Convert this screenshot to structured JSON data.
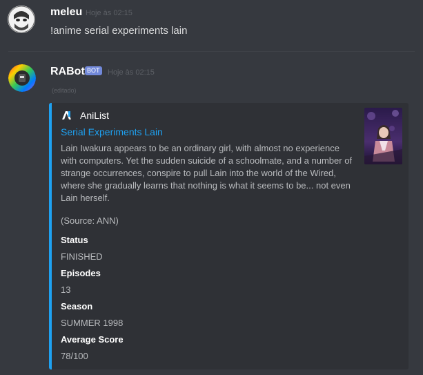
{
  "messages": [
    {
      "username": "meleu",
      "timestamp": "Hoje às 02:15",
      "content": "!anime serial experiments lain"
    },
    {
      "username": "RABot",
      "bot_tag": "BOT",
      "timestamp": "Hoje às 02:15",
      "edited": "(editado)"
    }
  ],
  "embed": {
    "author": "AniList",
    "title": "Serial Experiments Lain",
    "description": "Lain Iwakura appears to be an ordinary girl, with almost no experience with computers. Yet the sudden suicide of a schoolmate, and a number of strange occurrences, conspire to pull Lain into the world of the Wired, where she gradually learns that nothing is what it seems to be... not even Lain herself.",
    "source": "(Source: ANN)",
    "fields": [
      {
        "name": "Status",
        "value": "FINISHED"
      },
      {
        "name": "Episodes",
        "value": "13"
      },
      {
        "name": "Season",
        "value": "SUMMER 1998"
      },
      {
        "name": "Average Score",
        "value": "78/100"
      }
    ],
    "accent_color": "#1ea1f1"
  },
  "icons": {
    "user_avatar": "sketch-face-avatar",
    "bot_avatar": "rainbow-ring-avatar",
    "author_icon": "anilist-logo-icon",
    "thumbnail": "anime-cover-thumbnail"
  }
}
